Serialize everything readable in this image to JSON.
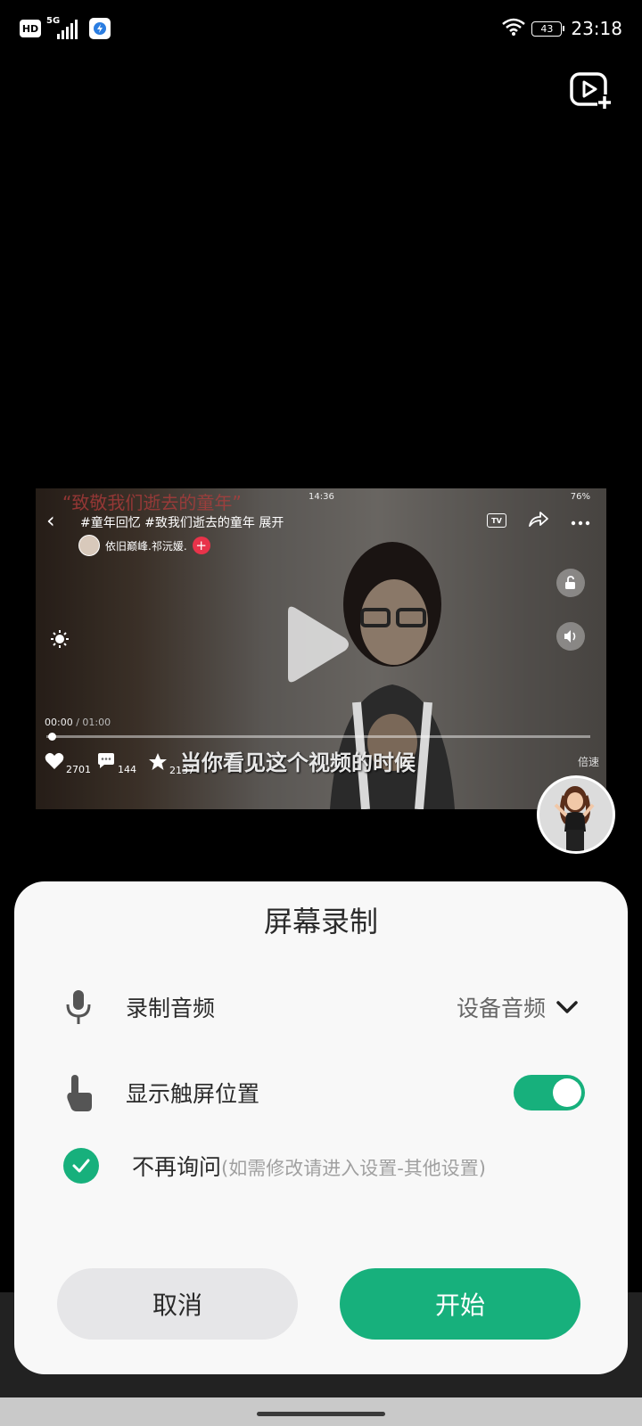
{
  "status_bar": {
    "hd": "HD",
    "network": "5G",
    "battery": "43",
    "time": "23:18"
  },
  "video": {
    "watermark": "“致敬我们逝去的童年”",
    "status_time": "14:36",
    "status_battery": "76%",
    "title": "#童年回忆 #致我们逝去的童年 展开",
    "tv_label": "TV",
    "author": "依旧巅峰.祁沅媛.",
    "follow_symbol": "+",
    "progress_current": "00:00",
    "progress_total": "/ 01:00",
    "progress_fraction": 0.01,
    "subtitle": "当你看见这个视频的时候",
    "likes": "2701",
    "comments": "144",
    "favorites": "2137",
    "speed": "倍速"
  },
  "dialog": {
    "title": "屏幕录制",
    "audio_label": "录制音频",
    "audio_value": "设备音频",
    "touch_label": "显示触屏位置",
    "touch_enabled": true,
    "no_ask_label": "不再询问",
    "no_ask_hint": "(如需修改请进入设置-其他设置)",
    "no_ask_checked": true,
    "cancel_label": "取消",
    "start_label": "开始"
  },
  "colors": {
    "accent": "#17b07c",
    "dialog_bg": "#f8f8f8",
    "cancel_bg": "#e6e6e8"
  },
  "icons": {
    "top_right": "video-add-icon",
    "audio": "microphone-icon",
    "touch": "touch-hand-icon",
    "dropdown": "chevron-down-icon"
  }
}
